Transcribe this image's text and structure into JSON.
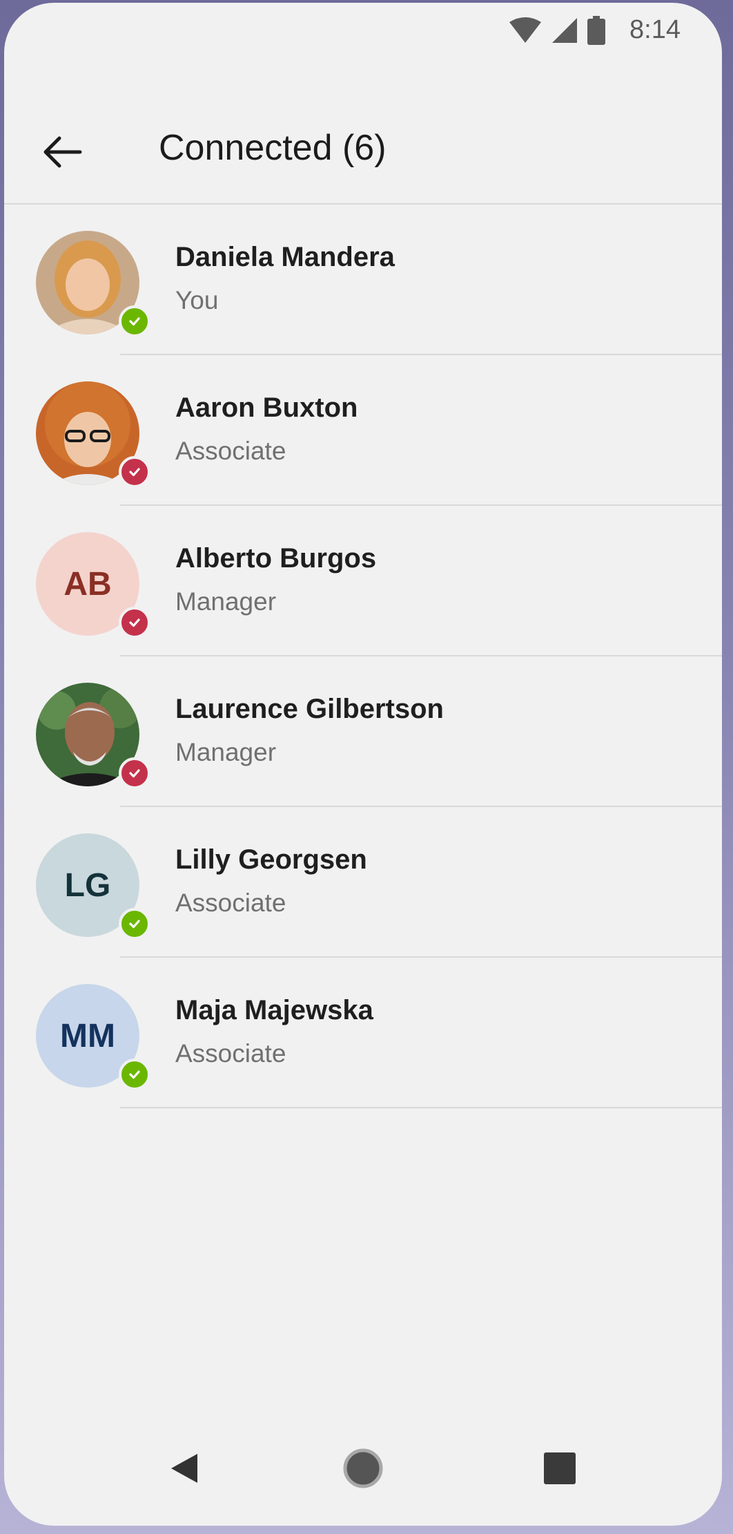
{
  "status": {
    "time": "8:14",
    "icons": [
      "wifi-icon",
      "signal-icon",
      "battery-icon"
    ]
  },
  "header": {
    "title": "Connected (6)",
    "back_icon": "arrow-left-icon"
  },
  "people": [
    {
      "name": "Daniela Mandera",
      "role": "You",
      "avatar": "photo",
      "status": "available"
    },
    {
      "name": "Aaron Buxton",
      "role": "Associate",
      "avatar": "photo",
      "status": "busy"
    },
    {
      "name": "Alberto Burgos",
      "role": "Manager",
      "initials": "AB",
      "avatar_color": "#f4d3cd",
      "initials_color": "#8a2f25",
      "status": "busy"
    },
    {
      "name": "Laurence Gilbertson",
      "role": "Manager",
      "avatar": "photo",
      "status": "busy"
    },
    {
      "name": "Lilly Georgsen",
      "role": "Associate",
      "initials": "LG",
      "avatar_color": "#c9d8dc",
      "initials_color": "#143239",
      "status": "available"
    },
    {
      "name": "Maja Majewska",
      "role": "Associate",
      "initials": "MM",
      "avatar_color": "#c7d6ea",
      "initials_color": "#14325e",
      "status": "available"
    }
  ],
  "colors": {
    "available": "#6bb700",
    "busy": "#c4314b"
  },
  "nav": [
    "back-triangle-icon",
    "home-circle-icon",
    "recents-square-icon"
  ]
}
